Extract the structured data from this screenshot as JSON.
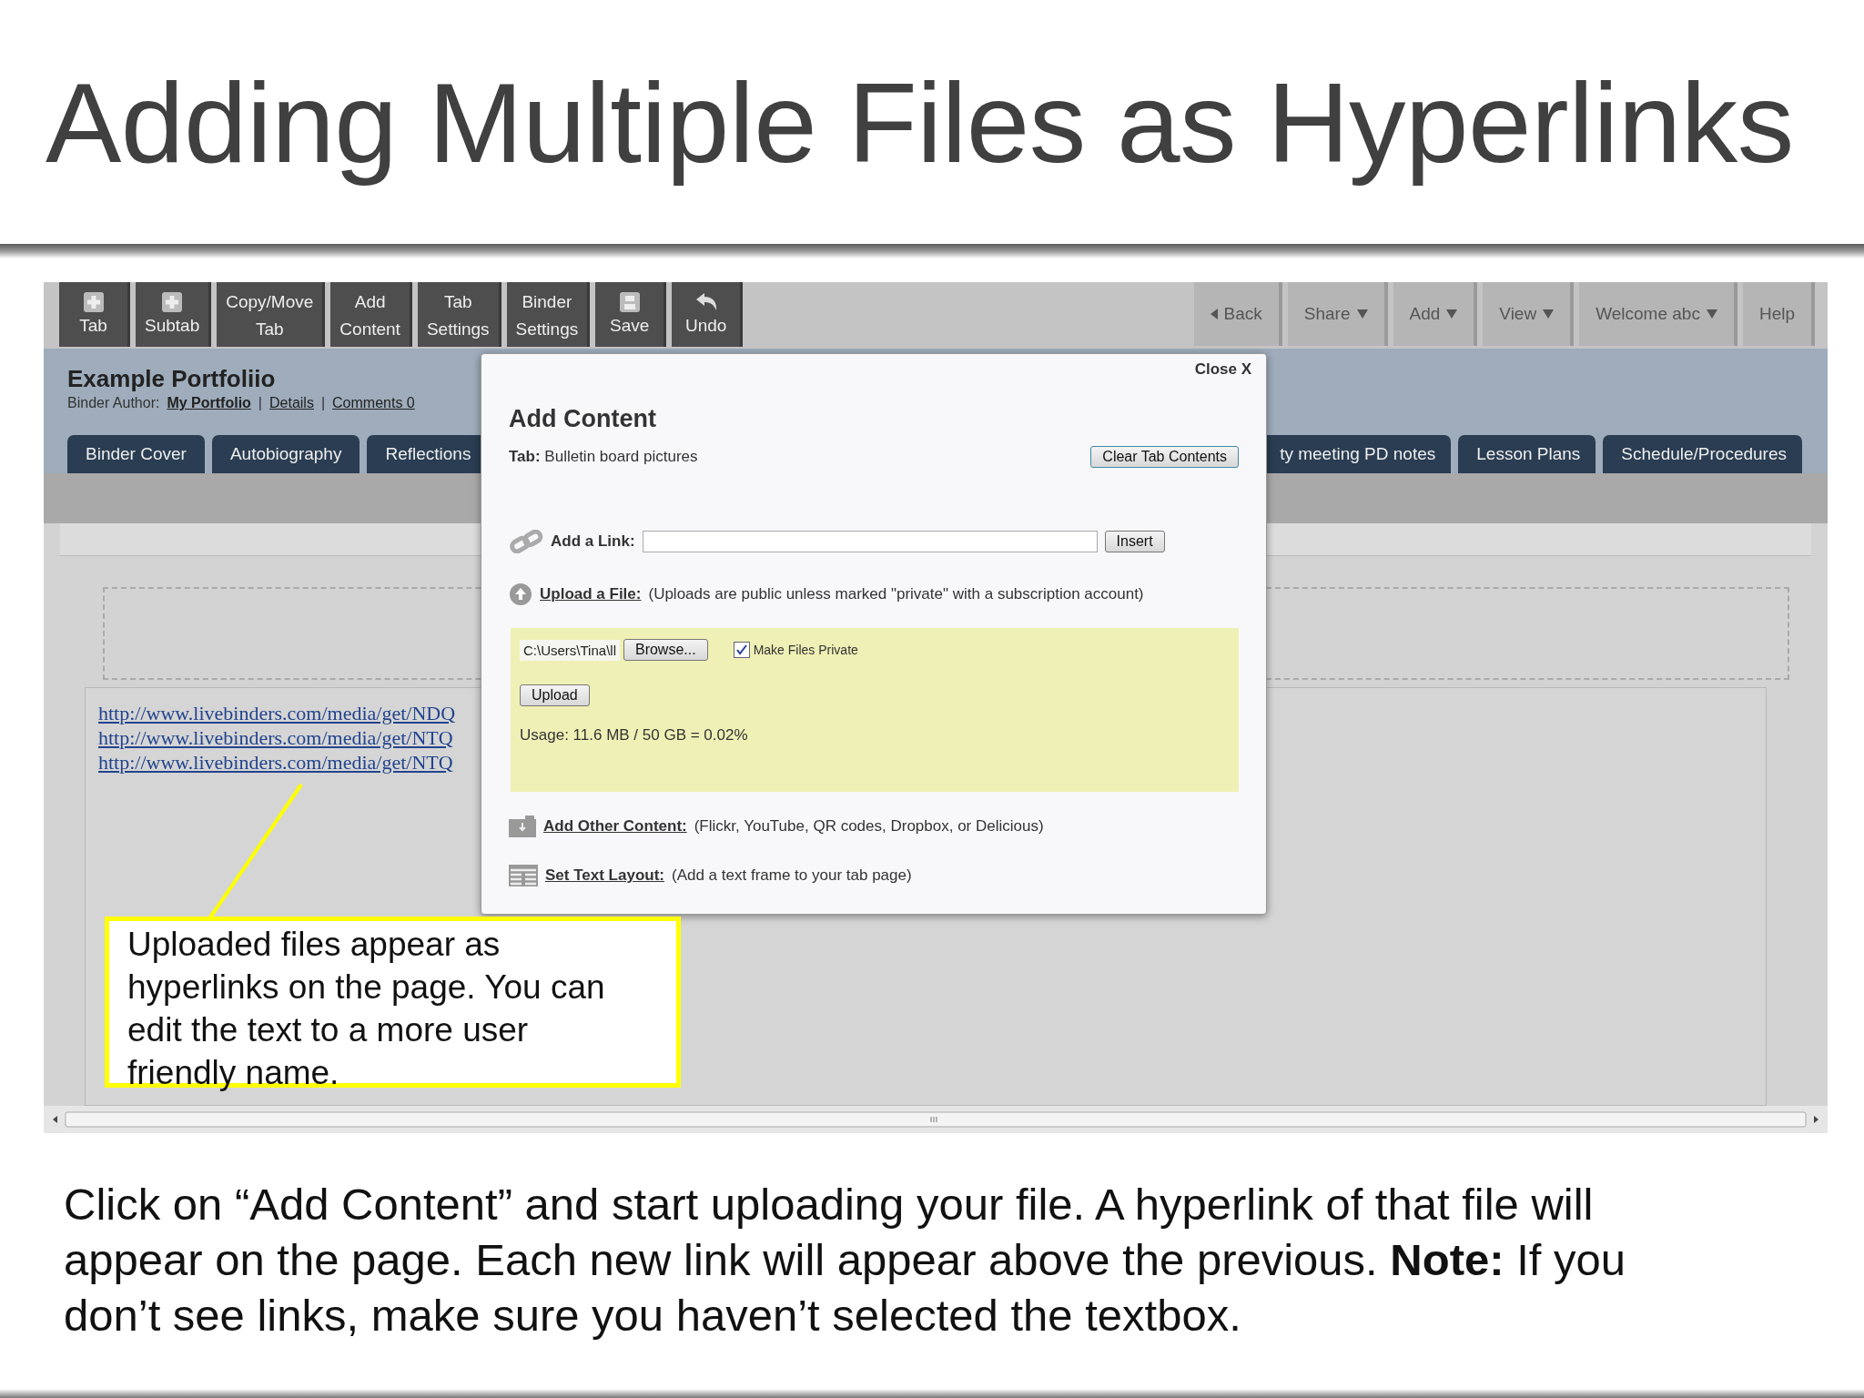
{
  "slide": {
    "title": "Adding Multiple Files as Hyperlinks",
    "caption": "Click on “Add Content” and start uploading your file. A hyperlink of that file will appear on the page. Each new link will appear above the previous. **Note:** If you don’t see links, make sure you haven’t selected the textbox."
  },
  "toolbar": {
    "left": [
      {
        "label": "Tab",
        "kind": "plus"
      },
      {
        "label": "Subtab",
        "kind": "plus"
      },
      {
        "label": "Copy/Move Tab",
        "kind": "text"
      },
      {
        "label": "Add Content",
        "kind": "text"
      },
      {
        "label": "Tab Settings",
        "kind": "text"
      },
      {
        "label": "Binder Settings",
        "kind": "text"
      },
      {
        "label": "Save",
        "kind": "save"
      },
      {
        "label": "Undo",
        "kind": "undo"
      }
    ],
    "right": [
      {
        "label": "Back",
        "kind": "back"
      },
      {
        "label": "Share",
        "kind": "menu"
      },
      {
        "label": "Add",
        "kind": "menu"
      },
      {
        "label": "View",
        "kind": "menu"
      },
      {
        "label": "Welcome abc",
        "kind": "menu"
      },
      {
        "label": "Help",
        "kind": "plain"
      }
    ]
  },
  "binder": {
    "title": "Example Portfoliio",
    "author_label": "Binder Author:",
    "links": [
      "My Portfolio",
      "Details",
      "Comments 0"
    ],
    "separator": "|"
  },
  "tabs_left": [
    "Binder Cover",
    "Autobiography",
    "Reflections"
  ],
  "tabs_right": [
    "ty meeting PD notes",
    "Lesson Plans",
    "Schedule/Procedures"
  ],
  "links": [
    "http://www.livebinders.com/media/get/NDQ",
    "http://www.livebinders.com/media/get/NTQ",
    "http://www.livebinders.com/media/get/NTQ"
  ],
  "dialog": {
    "close": "Close X",
    "title": "Add Content",
    "tab_line": "**Tab:** Bulletin board pictures",
    "clear_button": "Clear Tab Contents",
    "link": {
      "label": "Add a Link:",
      "button": "Insert"
    },
    "upload": {
      "label": "Upload a File:",
      "note": "(Uploads are public unless marked \"private\" with a subscription account)",
      "file_value": "C:\\Users\\Tina\\ll",
      "browse": "Browse...",
      "private_label": "Make Files Private",
      "private_checked": true,
      "upload_button": "Upload",
      "usage": "Usage: 11.6 MB / 50 GB = 0.02%"
    },
    "options": [
      {
        "label": "Add Other Content:",
        "note": "(Flickr, YouTube, QR codes, Dropbox, or Delicious)",
        "kind": "folder"
      },
      {
        "label": "Set Text Layout:",
        "note": "(Add a text frame to your tab page)",
        "kind": "layout"
      }
    ]
  },
  "callout": "Uploaded files appear as hyperlinks on the page. You can edit the text to a more user friendly name."
}
